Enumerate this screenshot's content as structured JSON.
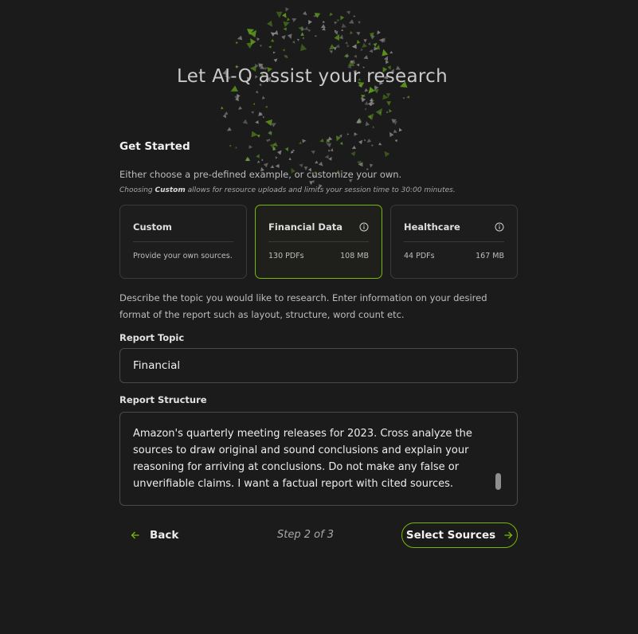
{
  "header": {
    "headline": "Let AI-Q assist your research"
  },
  "get_started": {
    "title": "Get Started",
    "intro": "Either choose a pre-defined example, or customize your own.",
    "note_prefix": "Choosing ",
    "note_emphasis": "Custom",
    "note_suffix": " allows for resource uploads and limits your session time to 30:00 minutes."
  },
  "cards": [
    {
      "title": "Custom",
      "description": "Provide your own sources.",
      "selected": false,
      "info_icon": null
    },
    {
      "title": "Financial Data",
      "left_meta": "130 PDFs",
      "right_meta": "108 MB",
      "selected": true,
      "info_icon": "info-icon"
    },
    {
      "title": "Healthcare",
      "left_meta": "44 PDFs",
      "right_meta": "167 MB",
      "selected": false,
      "info_icon": "info-icon"
    }
  ],
  "describe_text": "Describe the topic you would like to research. Enter information on your desired format of the report such as layout, structure, word count etc.",
  "report_topic": {
    "label": "Report Topic",
    "value": "Financial"
  },
  "report_structure": {
    "label": "Report Structure",
    "value": "Amazon's quarterly meeting releases for 2023. Cross analyze the sources to draw original and sound conclusions and explain your reasoning for arriving at conclusions. Do not make any false or unverifiable claims. I want a factual report with cited sources."
  },
  "footer": {
    "back_label": "Back",
    "step_label": "Step 2 of 3",
    "next_label": "Select Sources"
  },
  "colors": {
    "accent": "#76b900",
    "background": "#1b1b1b"
  }
}
